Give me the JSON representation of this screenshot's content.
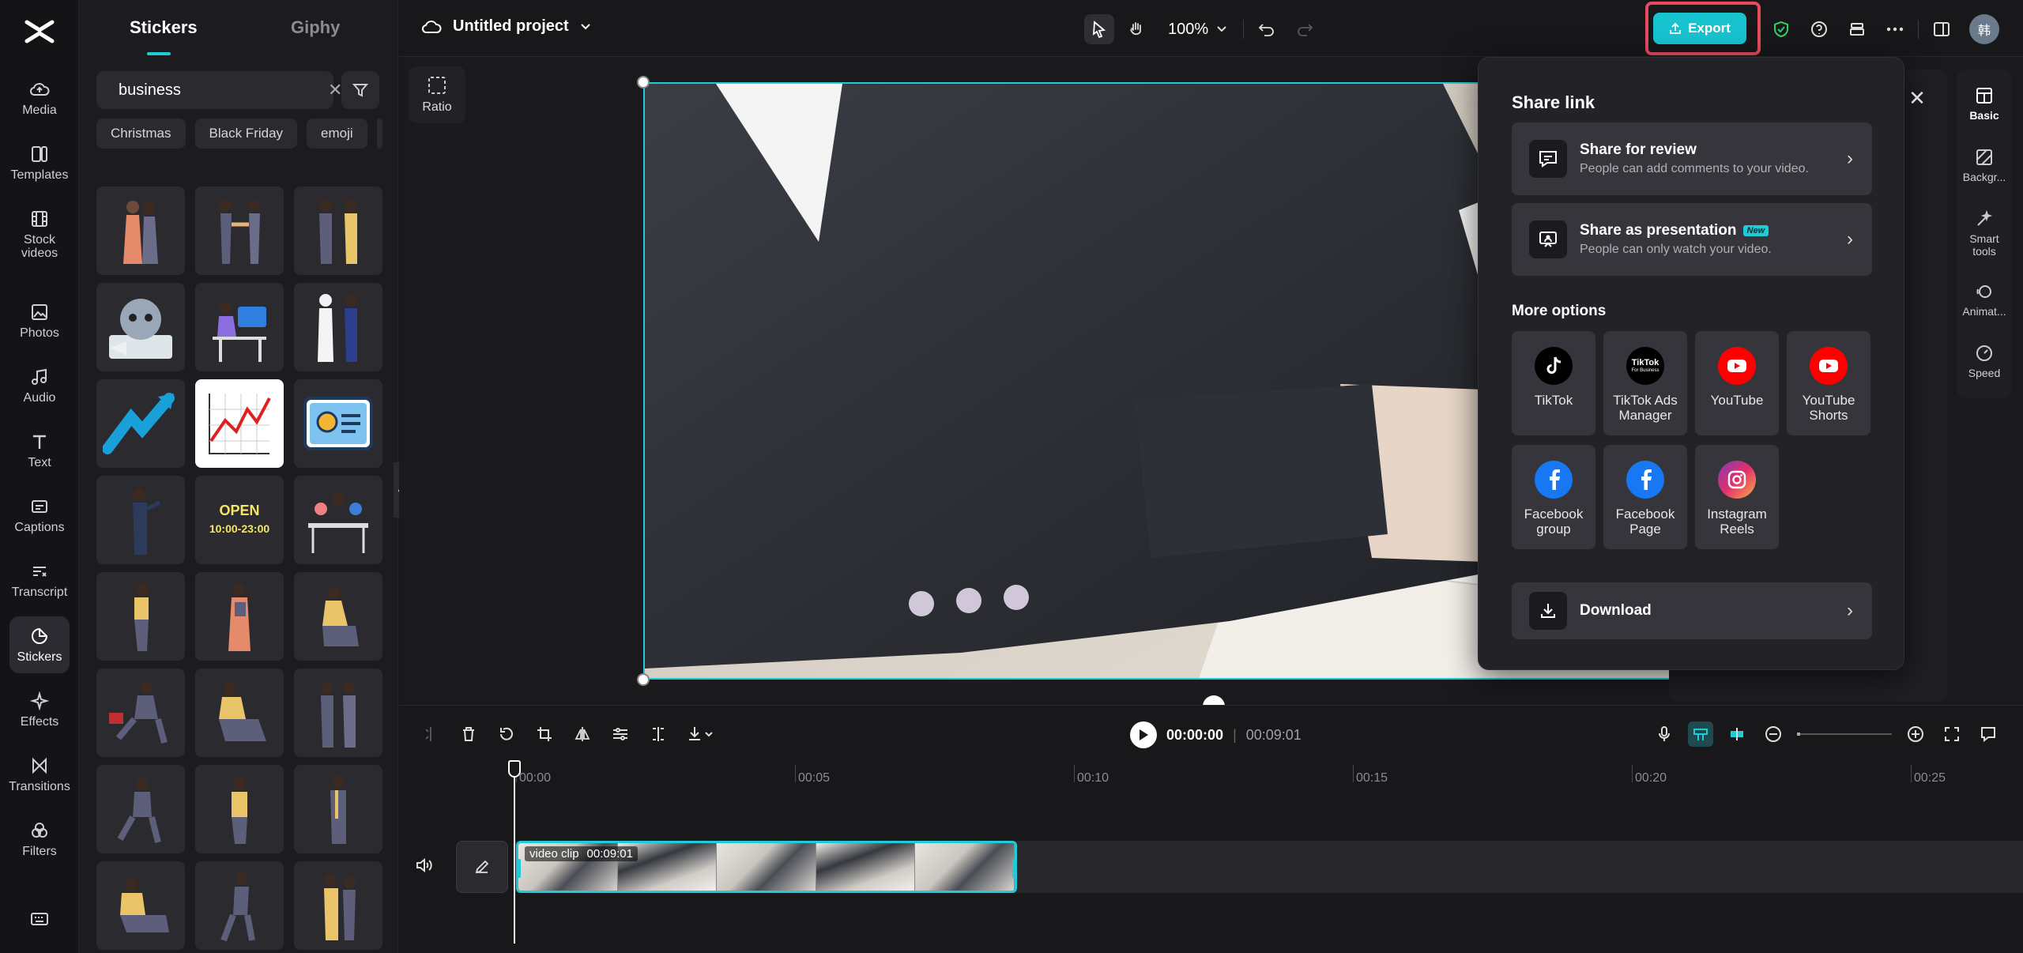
{
  "rail": {
    "items": [
      {
        "label": "Media",
        "icon": "cloud-upload-icon"
      },
      {
        "label": "Templates",
        "icon": "templates-icon"
      },
      {
        "label": "Stock\nvideos",
        "icon": "film-icon"
      },
      {
        "label": "Photos",
        "icon": "image-icon"
      },
      {
        "label": "Audio",
        "icon": "music-icon"
      },
      {
        "label": "Text",
        "icon": "text-icon"
      },
      {
        "label": "Captions",
        "icon": "captions-icon"
      },
      {
        "label": "Transcript",
        "icon": "transcript-icon"
      },
      {
        "label": "Stickers",
        "icon": "sticker-icon"
      },
      {
        "label": "Effects",
        "icon": "sparkle-icon"
      },
      {
        "label": "Transitions",
        "icon": "transition-icon"
      },
      {
        "label": "Filters",
        "icon": "filter-icon"
      }
    ]
  },
  "panel": {
    "tabs": [
      "Stickers",
      "Giphy"
    ],
    "search_value": "business",
    "chips": [
      "Christmas",
      "Black Friday",
      "emoji"
    ]
  },
  "topbar": {
    "project_name": "Untitled project",
    "zoom": "100%",
    "export_label": "Export",
    "avatar": "韩"
  },
  "stage": {
    "ratio_label": "Ratio"
  },
  "right_rail": {
    "items": [
      "Basic",
      "Backgr...",
      "Smart\ntools",
      "Animat...",
      "Speed"
    ]
  },
  "share": {
    "title": "Share link",
    "review_title": "Share for review",
    "review_sub": "People can add comments to your video.",
    "presentation_title": "Share as presentation",
    "presentation_badge": "New",
    "presentation_sub": "People can only watch your video.",
    "more_title": "More options",
    "options": [
      {
        "label": "TikTok",
        "color": "#000000"
      },
      {
        "label": "TikTok Ads\nManager",
        "color": "#000000"
      },
      {
        "label": "YouTube",
        "color": "#ff0000"
      },
      {
        "label": "YouTube\nShorts",
        "color": "#ff0000"
      },
      {
        "label": "Facebook\ngroup",
        "color": "#1877f2"
      },
      {
        "label": "Facebook\nPage",
        "color": "#1877f2"
      },
      {
        "label": "Instagram\nReels",
        "color": "#e1306c"
      }
    ],
    "tiktok_ads_badge": "TikTok",
    "tiktok_ads_sub": "For Business",
    "download_label": "Download"
  },
  "timeline": {
    "current_time": "00:00:00",
    "total_time": "00:09:01",
    "ticks": [
      "00:00",
      "00:05",
      "00:10",
      "00:15",
      "00:20",
      "00:25"
    ],
    "clip_name": "video clip",
    "clip_duration": "00:09:01"
  }
}
